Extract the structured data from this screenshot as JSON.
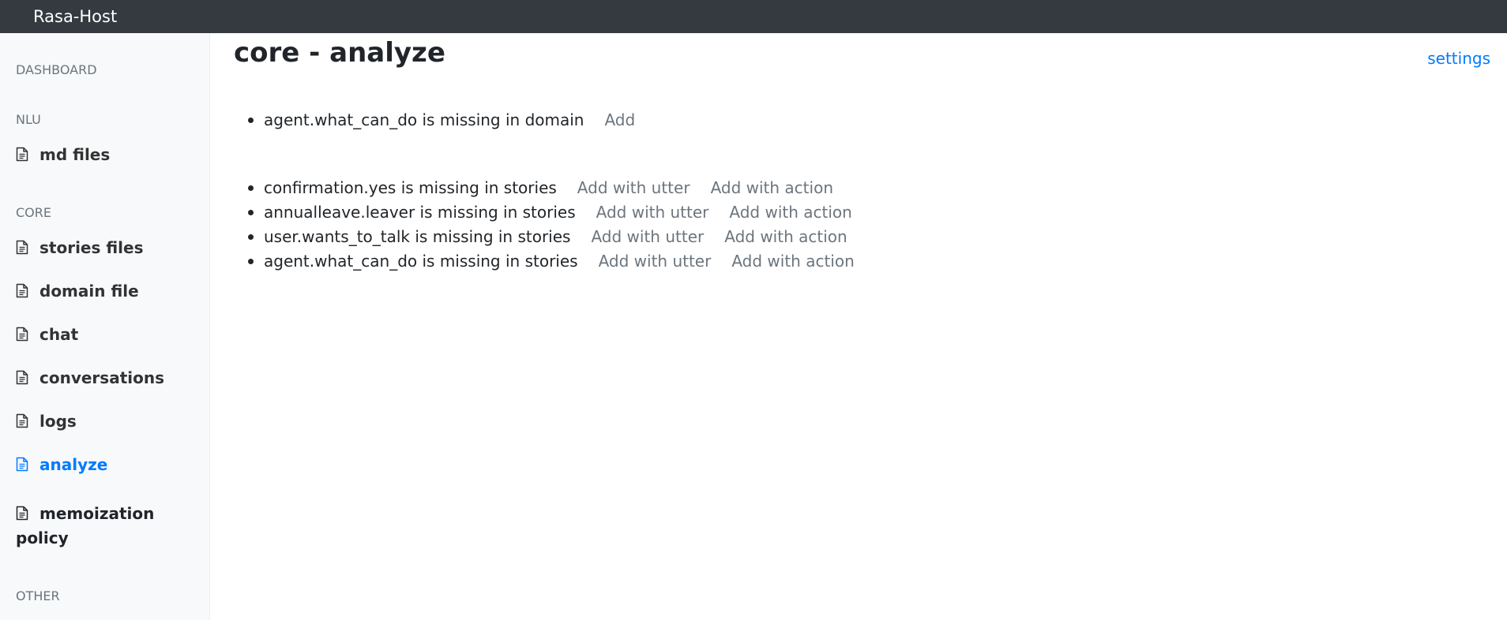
{
  "header": {
    "brand": "Rasa-Host"
  },
  "sidebar": {
    "sections": [
      {
        "label": "DASHBOARD",
        "items": []
      },
      {
        "label": "NLU",
        "items": [
          {
            "label": "md files",
            "icon": "file-text-icon"
          }
        ]
      },
      {
        "label": "CORE",
        "items": [
          {
            "label": "stories files",
            "icon": "file-text-icon"
          },
          {
            "label": "domain file",
            "icon": "file-text-icon"
          },
          {
            "label": "chat",
            "icon": "file-text-icon"
          },
          {
            "label": "conversations",
            "icon": "file-text-icon"
          },
          {
            "label": "logs",
            "icon": "file-text-icon"
          },
          {
            "label": "analyze",
            "icon": "file-text-icon",
            "active": true
          },
          {
            "label": "memoization policy",
            "icon": "file-text-icon"
          }
        ]
      },
      {
        "label": "OTHER",
        "items": []
      }
    ]
  },
  "main": {
    "title": "core - analyze",
    "settings_link": "settings",
    "domain_issues": [
      {
        "text": "agent.what_can_do is missing in domain",
        "action": "Add"
      }
    ],
    "story_issues": [
      {
        "text": "confirmation.yes is missing in stories",
        "action_utter": "Add with utter",
        "action_action": "Add with action"
      },
      {
        "text": "annualleave.leaver is missing in stories",
        "action_utter": "Add with utter",
        "action_action": "Add with action"
      },
      {
        "text": "user.wants_to_talk is missing in stories",
        "action_utter": "Add with utter",
        "action_action": "Add with action"
      },
      {
        "text": "agent.what_can_do is missing in stories",
        "action_utter": "Add with utter",
        "action_action": "Add with action"
      }
    ]
  },
  "colors": {
    "topbar": "#343a40",
    "sidebar": "#f8f9fa",
    "accent": "#007bff",
    "muted": "#6c757d"
  }
}
